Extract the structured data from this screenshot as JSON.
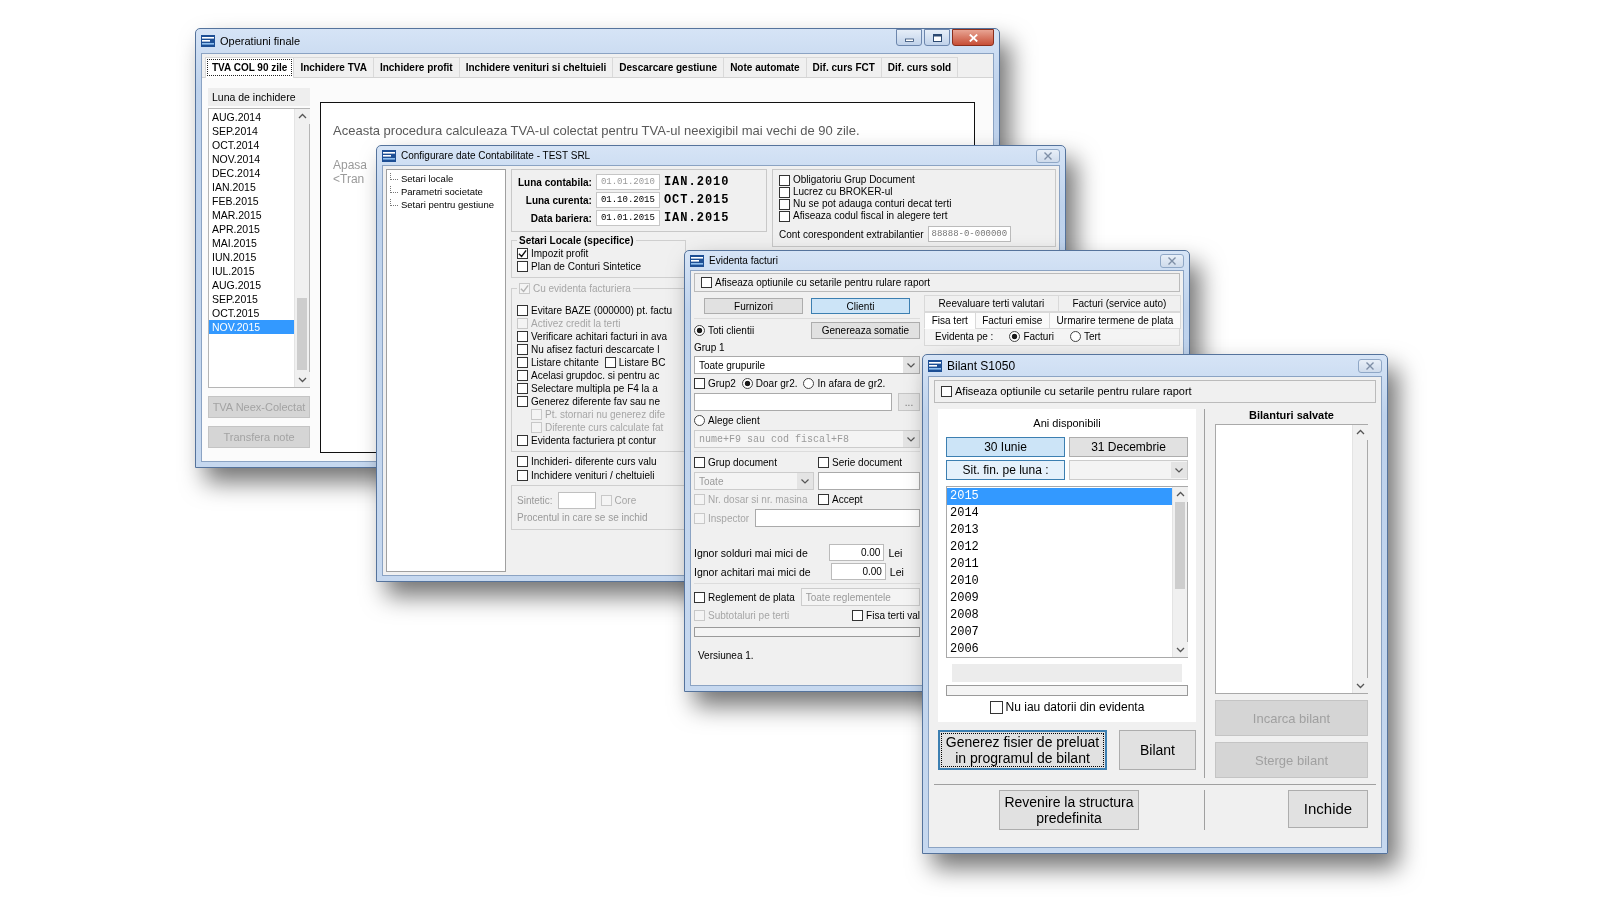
{
  "operations_window": {
    "title": "Operatiuni finale",
    "tabs": [
      {
        "label": "TVA COL 90 zile",
        "selected": true
      },
      {
        "label": "Inchidere TVA",
        "selected": false
      },
      {
        "label": "Inchidere profit",
        "selected": false
      },
      {
        "label": "Inchidere venituri si cheltuieli",
        "selected": false
      },
      {
        "label": "Descarcare gestiune",
        "selected": false
      },
      {
        "label": "Note automate",
        "selected": false
      },
      {
        "label": "Dif. curs FCT",
        "selected": false
      },
      {
        "label": "Dif. curs sold",
        "selected": false
      }
    ],
    "month_list": {
      "label": "Luna de inchidere",
      "items": [
        {
          "label": "AUG.2014",
          "selected": false
        },
        {
          "label": "SEP.2014",
          "selected": false
        },
        {
          "label": "OCT.2014",
          "selected": false
        },
        {
          "label": "NOV.2014",
          "selected": false
        },
        {
          "label": "DEC.2014",
          "selected": false
        },
        {
          "label": "IAN.2015",
          "selected": false
        },
        {
          "label": "FEB.2015",
          "selected": false
        },
        {
          "label": "MAR.2015",
          "selected": false
        },
        {
          "label": "APR.2015",
          "selected": false
        },
        {
          "label": "MAI.2015",
          "selected": false
        },
        {
          "label": "IUN.2015",
          "selected": false
        },
        {
          "label": "IUL.2015",
          "selected": false
        },
        {
          "label": "AUG.2015",
          "selected": false
        },
        {
          "label": "SEP.2015",
          "selected": false
        },
        {
          "label": "OCT.2015",
          "selected": false
        },
        {
          "label": "NOV.2015",
          "selected": true
        }
      ]
    },
    "buttons": [
      {
        "label": "TVA Neex-Colectat",
        "disabled": true
      },
      {
        "label": "Transfera note",
        "disabled": true
      }
    ],
    "description": "Aceasta procedura calculeaza TVA-ul colectat pentru TVA-ul neexigibil mai vechi de 90 zile.",
    "hint_lines": [
      "Apasa",
      "<Tran"
    ]
  },
  "config_window": {
    "title": "Configurare date Contabilitate - TEST SRL",
    "tree_items": [
      "Setari locale",
      "Parametri societate",
      "Setari pentru gestiune"
    ],
    "dates": [
      {
        "label": "Luna contabila:",
        "value": "01.01.2010",
        "disabled": true,
        "month": "IAN.2010"
      },
      {
        "label": "Luna curenta:",
        "value": "01.10.2015",
        "disabled": false,
        "month": "OCT.2015"
      },
      {
        "label": "Data bariera:",
        "value": "01.01.2015",
        "disabled": false,
        "month": "IAN.2015"
      }
    ],
    "general_options": [
      {
        "label": "Obligatoriu Grup Document",
        "checked": false
      },
      {
        "label": "Lucrez cu BROKER-ul",
        "checked": false
      },
      {
        "label": "Nu se pot adauga conturi decat terti",
        "checked": false
      },
      {
        "label": "Afiseaza codul fiscal in alegere tert",
        "checked": false
      }
    ],
    "account_field": {
      "label": "Cont corespondent extrabilantier",
      "value": "88888-0-000000"
    },
    "local_settings": {
      "title": "Setari Locale (specifice)",
      "options": [
        {
          "label": "Impozit profit",
          "checked": true
        },
        {
          "label": "Plan de Conturi Sintetice",
          "checked": false
        }
      ]
    },
    "invoicing": {
      "title": {
        "label": "Cu evidenta facturiera",
        "checked": true,
        "disabled": true
      },
      "options": [
        {
          "label": "Evitare BAZE (000000) pt. factu",
          "checked": false,
          "disabled": false
        },
        {
          "label": "Activez credit la terti",
          "checked": false,
          "disabled": true
        },
        {
          "label": "Verificare achitari facturi in ava",
          "checked": false,
          "disabled": false
        },
        {
          "label": "Nu afisez facturi descarcate l",
          "checked": false,
          "disabled": false
        },
        {
          "label": "Listare chitante",
          "checked": false,
          "disabled": false,
          "beside": {
            "label": "Listare BC",
            "checked": false,
            "disabled": false
          }
        },
        {
          "label": "Acelasi grupdoc. si pentru ac",
          "checked": false,
          "disabled": false
        },
        {
          "label": "Selectare multipla pe F4 la a",
          "checked": false,
          "disabled": false
        },
        {
          "label": "Generez diferente fav sau ne",
          "checked": false,
          "disabled": false,
          "children": [
            {
              "label": "Pt. stornari nu generez dife",
              "checked": false,
              "disabled": true
            },
            {
              "label": "Diferente curs calculate fat",
              "checked": false,
              "disabled": true
            }
          ]
        },
        {
          "label": "Evidenta facturiera pt contur",
          "checked": false,
          "disabled": false
        }
      ]
    },
    "closing_options": [
      {
        "label": "Inchideri- diferente curs valu",
        "checked": false
      },
      {
        "label": "Inchidere venituri / cheltuieli",
        "checked": false
      }
    ],
    "synthetic": {
      "label": "Sintetic:",
      "disabled": true,
      "option": {
        "label": "Core",
        "checked": false,
        "disabled": true
      },
      "note": "Procentul in care se se inchid"
    }
  },
  "invoices_window": {
    "title": "Evidenta facturi",
    "show_options": {
      "label": "Afiseaza optiunile cu setarile pentru rulare raport",
      "checked": false
    },
    "party_buttons": [
      {
        "label": "Furnizori",
        "selected": false
      },
      {
        "label": "Clienti",
        "selected": true
      }
    ],
    "all_clients": {
      "label": "Toti clientii",
      "selected": true
    },
    "reminder_button": "Genereaza somatie",
    "group1": {
      "label": "Grup 1",
      "value": "Toate grupurile"
    },
    "group2": {
      "label": "Grup2",
      "checked": false
    },
    "group2_mode": [
      {
        "label": "Doar gr2.",
        "selected": true
      },
      {
        "label": "In afara de gr2.",
        "selected": false
      }
    ],
    "browse_button": "...",
    "choose_client": {
      "label": "Alege client",
      "selected": false
    },
    "client_select": {
      "placeholder": "nume+F9 sau cod fiscal+F8",
      "disabled": true
    },
    "document_group": {
      "checkbox": {
        "label": "Grup document",
        "checked": false
      },
      "select": {
        "value": "Toate",
        "disabled": true
      }
    },
    "document_series": {
      "label": "Serie document",
      "checked": false
    },
    "file_number": {
      "label": "Nr. dosar si nr. masina",
      "checked": false,
      "disabled": true
    },
    "accept": {
      "label": "Accept",
      "checked": false
    },
    "inspector": {
      "label": "Inspector",
      "checked": false,
      "disabled": true
    },
    "thresholds": [
      {
        "label": "Ignor solduri mai mici de",
        "value": "0.00",
        "unit": "Lei"
      },
      {
        "label": "Ignor achitari mai mici de",
        "value": "0.00",
        "unit": "Lei"
      }
    ],
    "payment": {
      "checkbox": {
        "label": "Reglement de plata",
        "checked": false
      },
      "field": {
        "value": "Toate reglementele",
        "disabled": true
      }
    },
    "subtotals": {
      "label": "Subtotaluri pe terti",
      "checked": false,
      "disabled": true
    },
    "partner_statement": {
      "label": "Fisa terti val",
      "checked": false
    },
    "progress": {
      "level": 0
    },
    "version": "Versiunea 1.",
    "tab_rows": [
      [
        {
          "label": "Reevaluare terti valutari",
          "selected": false
        },
        {
          "label": "Facturi (service auto)",
          "selected": false
        }
      ],
      [
        {
          "label": "Fisa tert",
          "selected": true
        },
        {
          "label": "Facturi emise",
          "selected": false
        },
        {
          "label": "Urmarire termene de plata",
          "selected": false
        }
      ]
    ],
    "record_by": {
      "label": "Evidenta pe :",
      "options": [
        {
          "label": "Facturi",
          "selected": true
        },
        {
          "label": "Tert",
          "selected": false
        }
      ]
    }
  },
  "balance_window": {
    "title": "Bilant S1050",
    "show_options": {
      "label": "Afiseaza optiunile cu setarile pentru rulare raport",
      "checked": false
    },
    "years_title": "Ani disponibili",
    "period_buttons": [
      {
        "label": "30 Iunie",
        "selected": true
      },
      {
        "label": "31 Decembrie",
        "selected": false
      }
    ],
    "monthly_button": "Sit. fin. pe luna :",
    "month_select": {
      "disabled": true
    },
    "years": [
      {
        "label": "2015",
        "selected": true
      },
      {
        "label": "2014",
        "selected": false
      },
      {
        "label": "2013",
        "selected": false
      },
      {
        "label": "2012",
        "selected": false
      },
      {
        "label": "2011",
        "selected": false
      },
      {
        "label": "2010",
        "selected": false
      },
      {
        "label": "2009",
        "selected": false
      },
      {
        "label": "2008",
        "selected": false
      },
      {
        "label": "2007",
        "selected": false
      },
      {
        "label": "2006",
        "selected": false
      }
    ],
    "progress": {
      "level": 0
    },
    "no_debts": {
      "label": "Nu iau datorii din evidenta",
      "checked": false
    },
    "generate_button": {
      "label": "Generez fisier de preluat in programul de bilant",
      "focused": true
    },
    "balance_button": "Bilant",
    "saved_title": "Bilanturi salvate",
    "saved_buttons": [
      {
        "label": "Incarca bilant",
        "disabled": true
      },
      {
        "label": "Sterge bilant",
        "disabled": true
      }
    ],
    "reset_button": "Revenire la structura predefinita",
    "close_button": "Inchide"
  }
}
